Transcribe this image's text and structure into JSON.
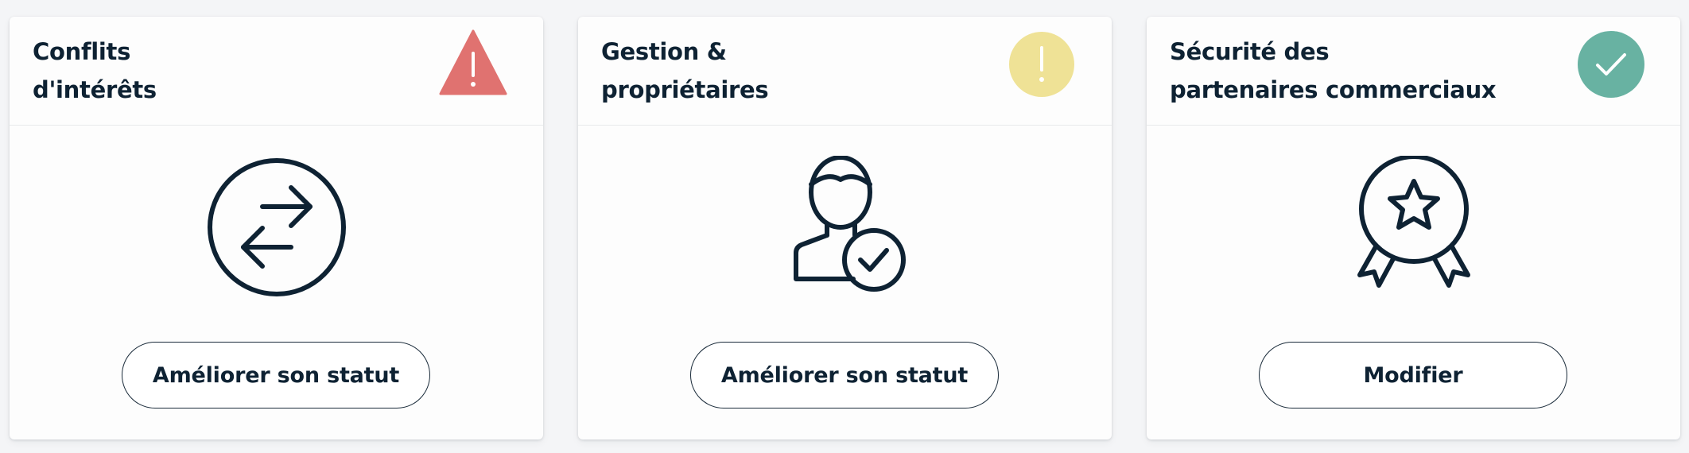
{
  "cards": [
    {
      "title_lines": [
        "Conflits",
        "d'intérêts"
      ],
      "status": "warning",
      "status_icon": "warning-triangle-icon",
      "status_color": "#e07270",
      "illustration": "arrows-exchange-icon",
      "button_label": "Améliorer son statut"
    },
    {
      "title_lines": [
        "Gestion &",
        "propriétaires"
      ],
      "status": "attention",
      "status_icon": "exclamation-circle-icon",
      "status_color": "#efe296",
      "illustration": "person-check-icon",
      "button_label": "Améliorer son statut"
    },
    {
      "title_lines": [
        "Sécurité des",
        "partenaires commerciaux"
      ],
      "status": "ok",
      "status_icon": "check-circle-icon",
      "status_color": "#68b2a2",
      "illustration": "award-ribbon-icon",
      "button_label": "Modifier"
    }
  ],
  "colors": {
    "ink": "#0e2233",
    "background": "#f4f5f7",
    "card": "#fdfdfd"
  }
}
